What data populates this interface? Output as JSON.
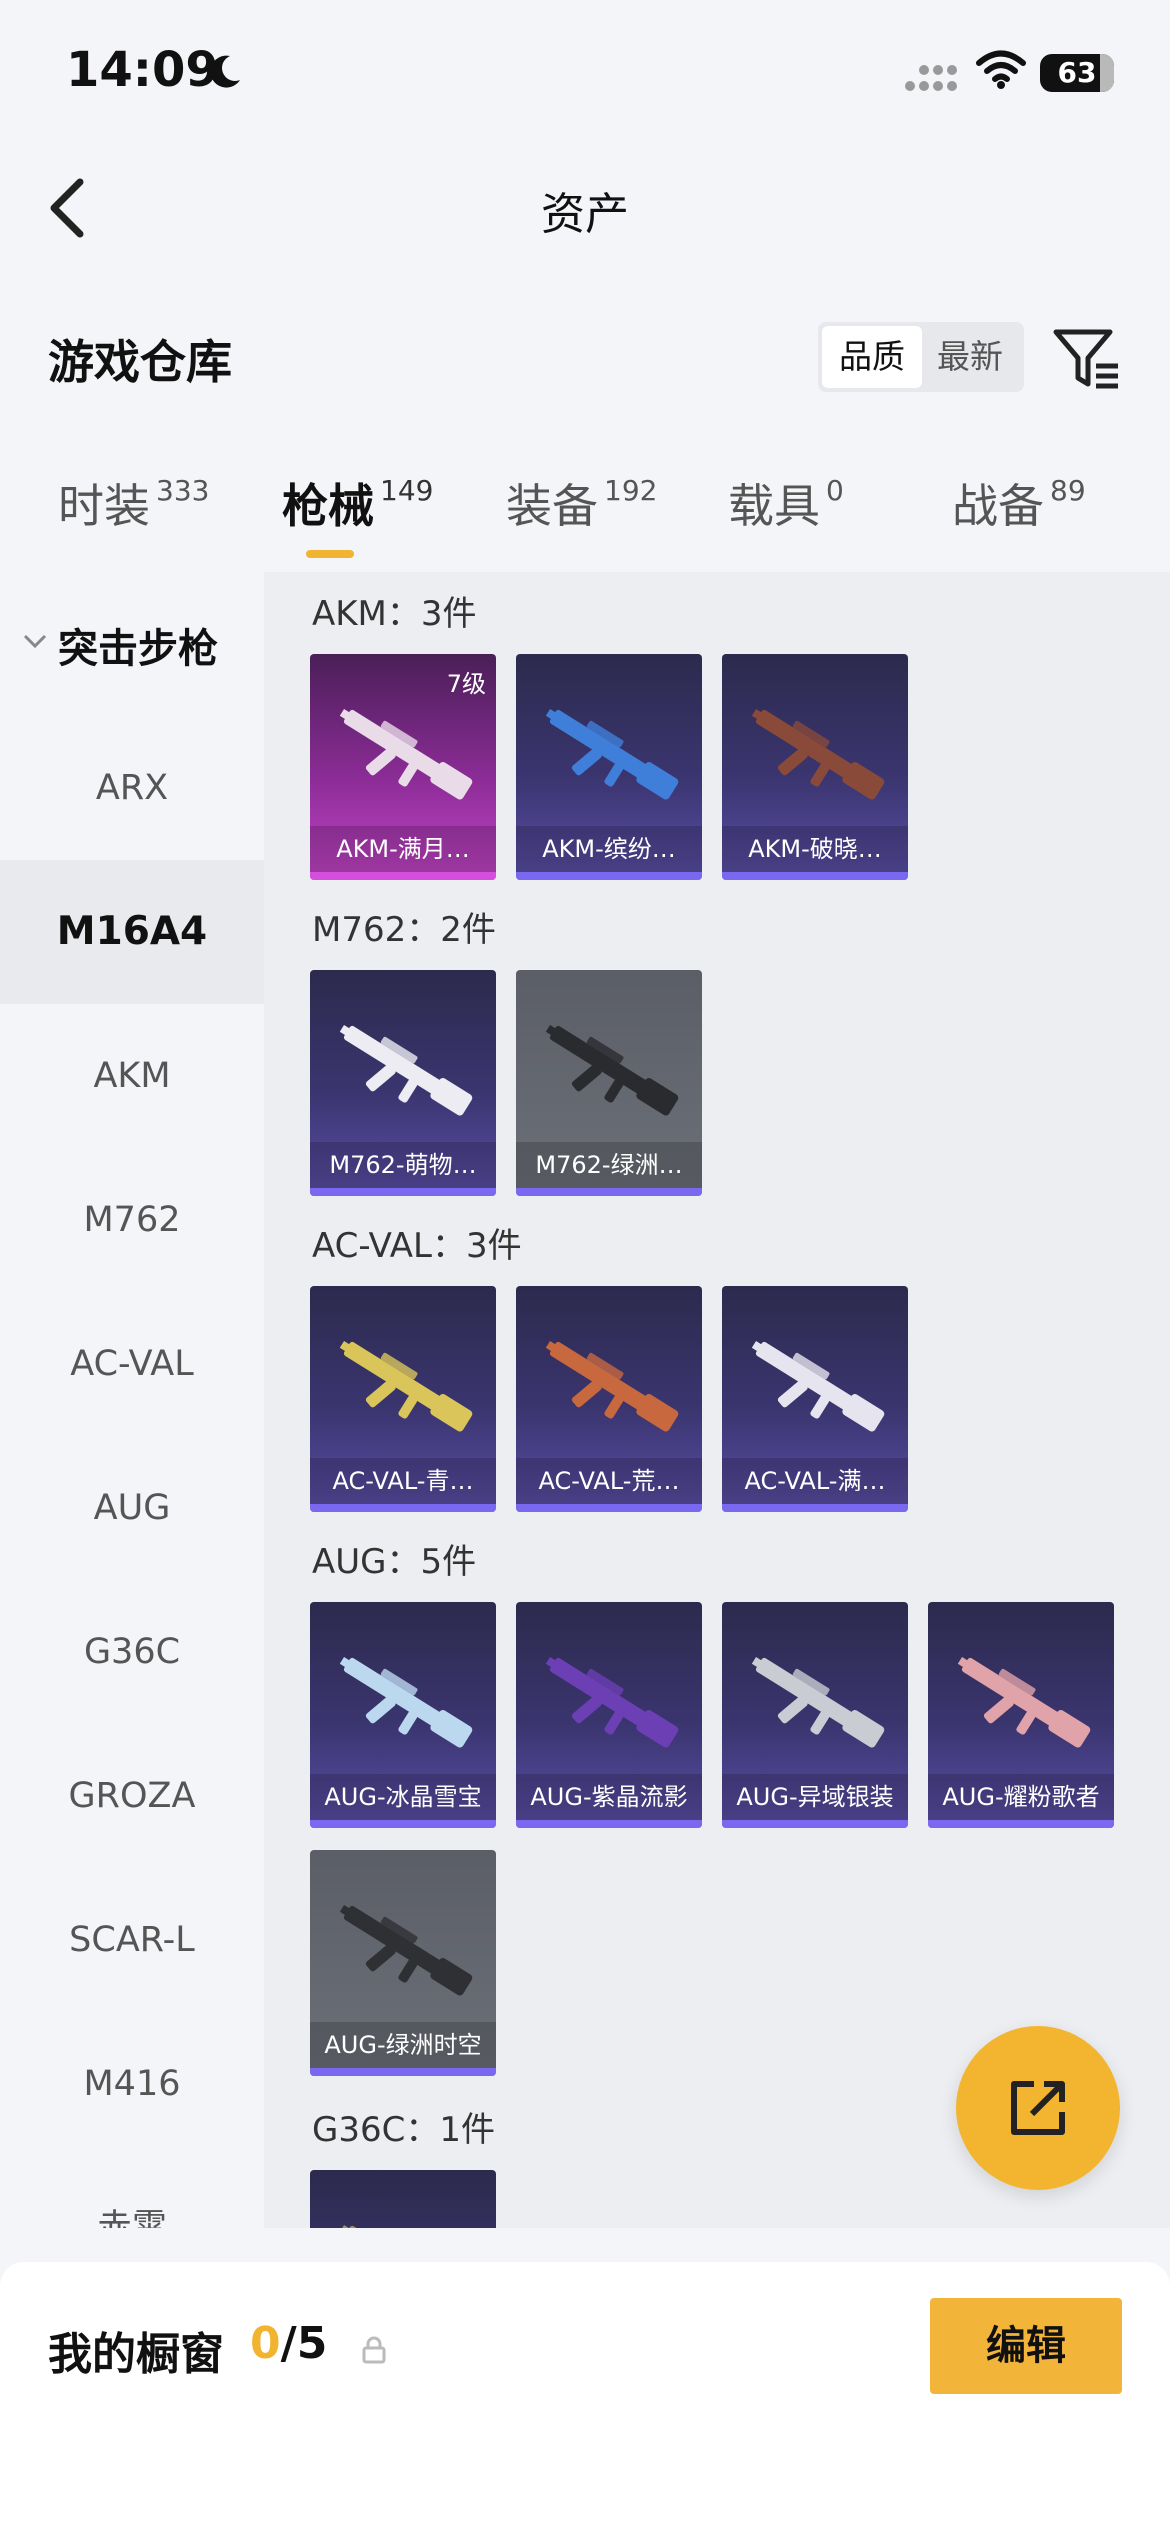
{
  "status_bar": {
    "time": "14:09",
    "battery": "63"
  },
  "nav": {
    "title": "资产"
  },
  "warehouse": {
    "title": "游戏仓库",
    "sort_options": [
      "品质",
      "最新"
    ],
    "sort_selected": "品质"
  },
  "tabs": [
    {
      "label": "时装",
      "count": "333"
    },
    {
      "label": "枪械",
      "count": "149",
      "active": true
    },
    {
      "label": "装备",
      "count": "192"
    },
    {
      "label": "载具",
      "count": "0"
    },
    {
      "label": "战备",
      "count": "89"
    }
  ],
  "sidebar": {
    "group": "突击步枪",
    "items": [
      "ARX",
      "M16A4",
      "AKM",
      "M762",
      "AC-VAL",
      "AUG",
      "G36C",
      "GROZA",
      "SCAR-L",
      "M416",
      "赤霄"
    ],
    "selected": "M16A4"
  },
  "groups": [
    {
      "label": "AKM：3件",
      "cards": [
        {
          "name": "AKM-满月…",
          "level": "7级",
          "rarity": "pink",
          "gun_color": "#e9dbe8"
        },
        {
          "name": "AKM-缤纷…",
          "rarity": "purple",
          "gun_color": "#3f7fd9"
        },
        {
          "name": "AKM-破晓…",
          "rarity": "purple",
          "gun_color": "#8a4a3a"
        }
      ]
    },
    {
      "label": "M762：2件",
      "cards": [
        {
          "name": "M762-萌物…",
          "rarity": "purple",
          "gun_color": "#ececf2"
        },
        {
          "name": "M762-绿洲…",
          "rarity": "grey",
          "gun_color": "#2a2b2f"
        }
      ]
    },
    {
      "label": "AC-VAL：3件",
      "cards": [
        {
          "name": "AC-VAL-青…",
          "rarity": "purple",
          "gun_color": "#d9c55a"
        },
        {
          "name": "AC-VAL-荒…",
          "rarity": "purple",
          "gun_color": "#c8683e"
        },
        {
          "name": "AC-VAL-满…",
          "rarity": "purple",
          "gun_color": "#e6e4ee"
        }
      ]
    },
    {
      "label": "AUG：5件",
      "cards": [
        {
          "name": "AUG-冰晶雪宝",
          "rarity": "purple",
          "gun_color": "#bcd8ef"
        },
        {
          "name": "AUG-紫晶流影",
          "rarity": "purple",
          "gun_color": "#6c3fb5"
        },
        {
          "name": "AUG-异域银装",
          "rarity": "purple",
          "gun_color": "#c9ccd2"
        },
        {
          "name": "AUG-耀粉歌者",
          "rarity": "purple",
          "gun_color": "#e0a3a9"
        },
        {
          "name": "AUG-绿洲时空",
          "rarity": "grey",
          "gun_color": "#2e3034"
        }
      ]
    },
    {
      "label": "G36C：1件",
      "cards": [
        {
          "name": "",
          "rarity": "purple",
          "gun_color": "#a68c55"
        }
      ]
    }
  ],
  "showcase": {
    "label": "我的橱窗",
    "current": "0",
    "total": "/5",
    "edit_label": "编辑"
  },
  "colors": {
    "accent": "#f2b430",
    "card_purple": "#3b3570",
    "card_pink": "#8b2c96",
    "card_grey": "#6c7078"
  }
}
